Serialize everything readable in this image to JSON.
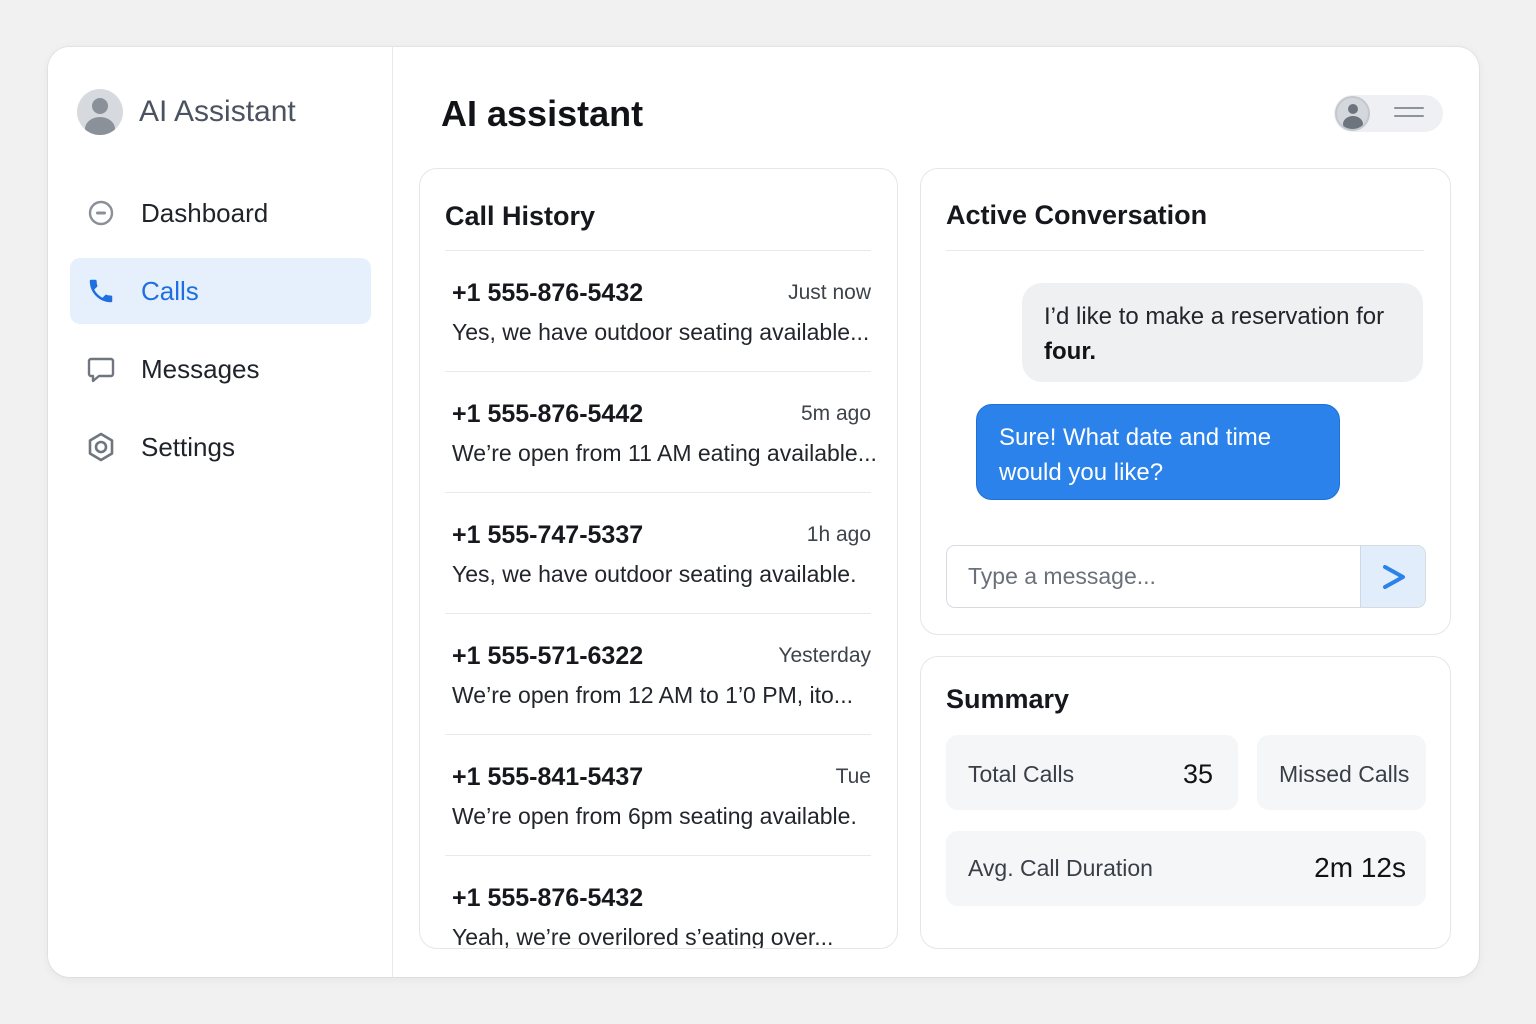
{
  "sidebar": {
    "brand_title": "AI Assistant",
    "items": [
      {
        "label": "Dashboard",
        "icon": "dashboard-icon",
        "active": false
      },
      {
        "label": "Calls",
        "icon": "phone-icon",
        "active": true
      },
      {
        "label": "Messages",
        "icon": "message-icon",
        "active": false
      },
      {
        "label": "Settings",
        "icon": "gear-icon",
        "active": false
      }
    ]
  },
  "header": {
    "title": "AI assistant"
  },
  "history": {
    "title": "Call History",
    "calls": [
      {
        "number": "+1 555-876-5432",
        "time": "Just now",
        "preview": "Yes, we have outdoor seating available..."
      },
      {
        "number": "+1 555-876-5442",
        "time": "5m ago",
        "preview": "We’re open from 11 AM eating available..."
      },
      {
        "number": "+1 555-747-5337",
        "time": "1h ago",
        "preview": "Yes, we have outdoor seating available."
      },
      {
        "number": "+1 555-571-6322",
        "time": "Yesterday",
        "preview": "We’re open from 12 AM to 1’0 PM, ito..."
      },
      {
        "number": "+1 555-841-5437",
        "time": "Tue",
        "preview": "We’re open from 6pm seating available."
      },
      {
        "number": "+1 555-876-5432",
        "time": "",
        "preview": "Yeah, we’re overilored s’eating over..."
      }
    ]
  },
  "conversation": {
    "title": "Active Conversation",
    "incoming_text": "I’d like to make a reservation for ",
    "incoming_bold": "four.",
    "outgoing_text": "Sure! What date and time would you like?",
    "input_placeholder": "Type a message..."
  },
  "summary": {
    "title": "Summary",
    "total_calls_label": "Total Calls",
    "total_calls_value": "35",
    "missed_calls_label": "Missed Calls",
    "avg_duration_label": "Avg. Call Duration",
    "avg_duration_value": "2m 12s"
  },
  "colors": {
    "accent": "#2b82ea",
    "active_nav_bg": "#e6f0fd",
    "active_nav_text": "#1f6fe0"
  }
}
